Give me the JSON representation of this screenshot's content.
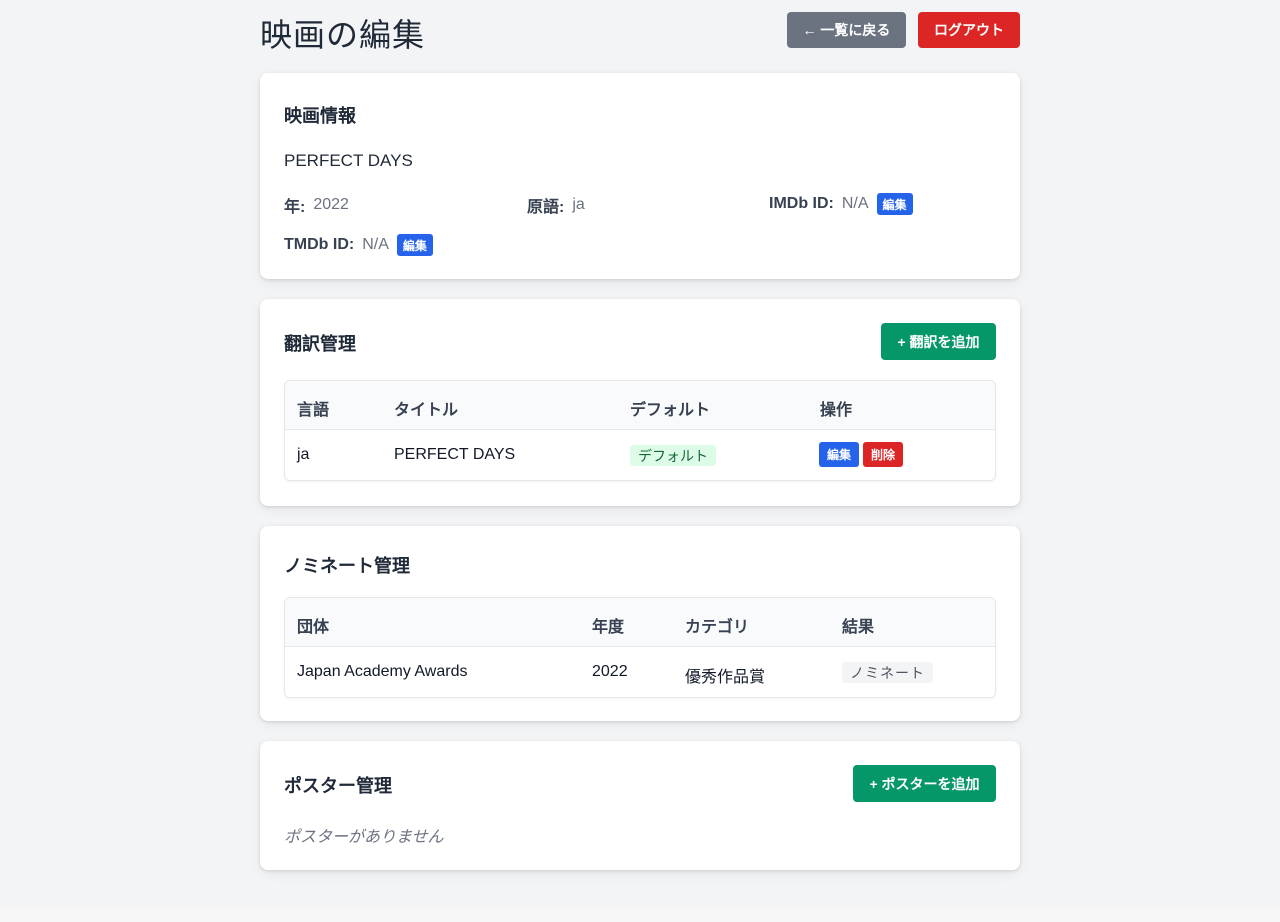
{
  "header": {
    "title": "映画の編集",
    "back_label": "← 一覧に戻る",
    "logout_label": "ログアウト"
  },
  "movie_info": {
    "section_title": "映画情報",
    "name": "PERFECT DAYS",
    "year_label": "年:",
    "year_value": "2022",
    "original_lang_label": "原語:",
    "original_lang_value": "ja",
    "imdb_label": "IMDb ID:",
    "imdb_value": "N/A",
    "imdb_edit": "編集",
    "tmdb_label": "TMDb ID:",
    "tmdb_value": "N/A",
    "tmdb_edit": "編集"
  },
  "translations": {
    "section_title": "翻訳管理",
    "add_label": "+ 翻訳を追加",
    "columns": [
      "言語",
      "タイトル",
      "デフォルト",
      "操作"
    ],
    "rows": [
      {
        "language": "ja",
        "title": "PERFECT DAYS",
        "default_tag": "デフォルト",
        "edit": "編集",
        "delete": "削除"
      }
    ]
  },
  "nominations": {
    "section_title": "ノミネート管理",
    "columns": [
      "団体",
      "年度",
      "カテゴリ",
      "結果"
    ],
    "rows": [
      {
        "organization": "Japan Academy Awards",
        "year": "2022",
        "category": "優秀作品賞",
        "result": "ノミネート"
      }
    ]
  },
  "posters": {
    "section_title": "ポスター管理",
    "add_label": "+ ポスターを追加",
    "empty_message": "ポスターがありません"
  },
  "colors": {
    "primary_blue": "#2563eb",
    "danger_red": "#dc2626",
    "success_green": "#059669",
    "secondary_gray": "#6b7280",
    "background": "#f3f4f6"
  }
}
